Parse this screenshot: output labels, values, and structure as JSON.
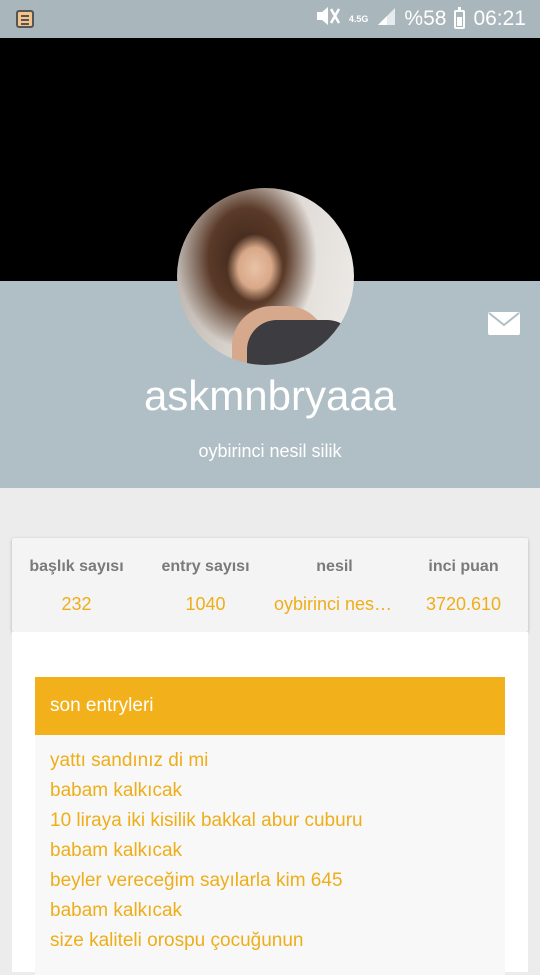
{
  "status_bar": {
    "battery_text": "%58",
    "time": "06:21",
    "network_label": "4.5G",
    "icons": [
      "notification-app-icon",
      "mute-icon",
      "signal-icon",
      "battery-icon"
    ],
    "text_color": "#ffffff",
    "bg_color": "#a9b6bc"
  },
  "profile": {
    "username": "askmnbryaaa",
    "generation_text": "oybirinci nesil silik",
    "band_color": "#b0bec5"
  },
  "stats": [
    {
      "label": "başlık sayısı",
      "value": "232"
    },
    {
      "label": "entry sayısı",
      "value": "1040"
    },
    {
      "label": "nesil",
      "value": "oybirinci nesil silik"
    },
    {
      "label": "inci puan",
      "value": "3720.610"
    }
  ],
  "entries": {
    "header": "son entryleri",
    "accent_color": "#f2b01a",
    "items": [
      "yattı sandınız di mi",
      "babam kalkıcak",
      "10 liraya iki kisilik bakkal abur cuburu",
      "babam kalkıcak",
      "beyler vereceğim sayılarla kim 645",
      "babam kalkıcak",
      "size kaliteli orospu çocuğunun"
    ]
  }
}
